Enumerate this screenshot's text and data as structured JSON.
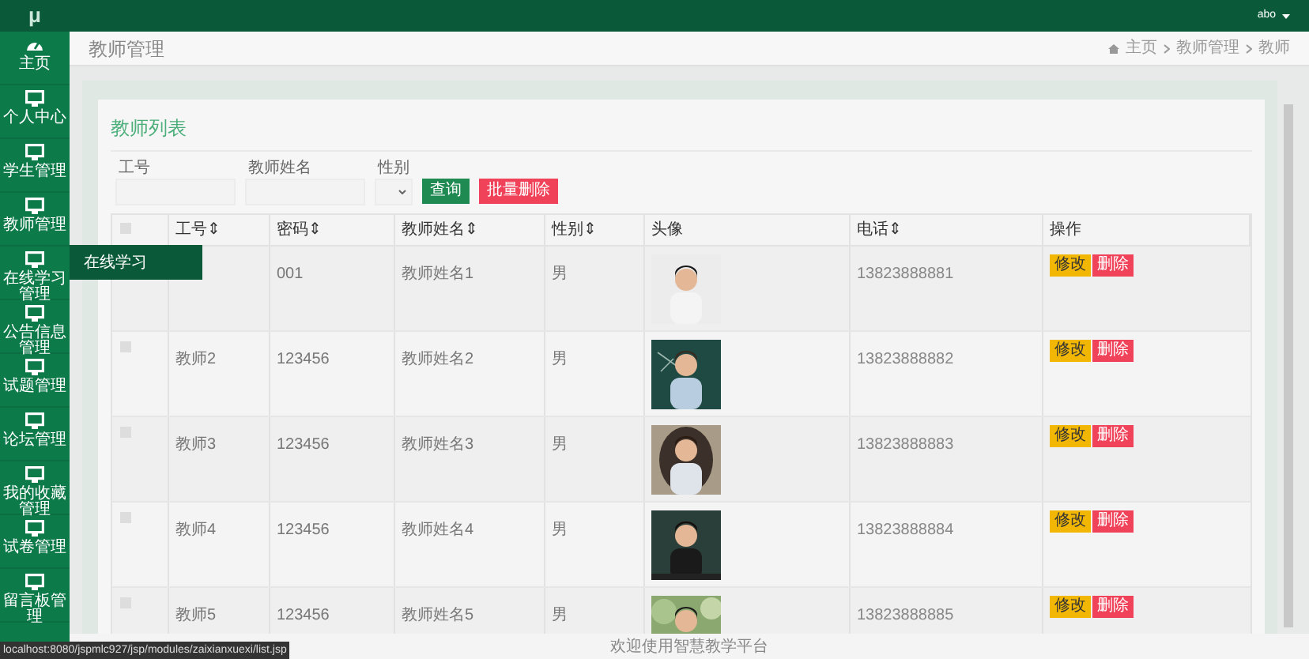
{
  "topbar": {
    "logo": "μ",
    "user": "abo"
  },
  "sidebar": {
    "items": [
      {
        "label": "主页",
        "kind": "dashboard"
      },
      {
        "label": "个人中心",
        "kind": "monitor"
      },
      {
        "label": "学生管理",
        "kind": "monitor"
      },
      {
        "label": "教师管理",
        "kind": "monitor"
      },
      {
        "label": "在线学习管理",
        "kind": "monitor"
      },
      {
        "label": "公告信息管理",
        "kind": "monitor"
      },
      {
        "label": "试题管理",
        "kind": "monitor"
      },
      {
        "label": "论坛管理",
        "kind": "monitor"
      },
      {
        "label": "我的收藏管理",
        "kind": "monitor"
      },
      {
        "label": "试卷管理",
        "kind": "monitor"
      },
      {
        "label": "留言板管理",
        "kind": "monitor"
      }
    ]
  },
  "flyout": {
    "label": "在线学习"
  },
  "header": {
    "title": "教师管理",
    "breadcrumb": [
      "主页",
      "教师管理",
      "教师"
    ]
  },
  "card": {
    "title": "教师列表",
    "filters": [
      {
        "label": "工号",
        "kind": "input"
      },
      {
        "label": "教师姓名",
        "kind": "input"
      },
      {
        "label": "性别",
        "kind": "select"
      }
    ],
    "buttons": [
      {
        "label": "查询",
        "kind": "primary"
      },
      {
        "label": "批量删除",
        "kind": "danger"
      }
    ],
    "table": {
      "select_all": {
        "checked": false
      },
      "columns": [
        {
          "label": "工号⇕"
        },
        {
          "label": "密码⇕"
        },
        {
          "label": "教师姓名⇕"
        },
        {
          "label": "性别⇕"
        },
        {
          "label": "头像"
        },
        {
          "label": "电话⇕"
        },
        {
          "label": "操作"
        }
      ],
      "rows": [
        {
          "password": "001",
          "name": "教师姓名1",
          "gender": "男",
          "avatar": {
            "kind": "picture"
          },
          "phone": "13823888881",
          "actions": [
            "修改",
            "删除"
          ]
        },
        {
          "checked": false,
          "id": "教师2",
          "password": "123456",
          "name": "教师姓名2",
          "gender": "男",
          "avatar": {
            "kind": "picture"
          },
          "phone": "13823888882",
          "actions": [
            "修改",
            "删除"
          ]
        },
        {
          "checked": false,
          "id": "教师3",
          "password": "123456",
          "name": "教师姓名3",
          "gender": "男",
          "avatar": {
            "kind": "picture"
          },
          "phone": "13823888883",
          "actions": [
            "修改",
            "删除"
          ]
        },
        {
          "checked": false,
          "id": "教师4",
          "password": "123456",
          "name": "教师姓名4",
          "gender": "男",
          "avatar": {
            "kind": "picture"
          },
          "phone": "13823888884",
          "actions": [
            "修改",
            "删除"
          ]
        },
        {
          "checked": false,
          "id": "教师5",
          "password": "123456",
          "name": "教师姓名5",
          "gender": "男",
          "avatar": {
            "kind": "picture"
          },
          "phone": "13823888885",
          "actions": [
            "修改",
            "删除"
          ]
        }
      ]
    }
  },
  "footer": "欢迎使用智慧教学平台",
  "status_bar": "localhost:8080/jspmlc927/jsp/modules/zaixianxuexi/list.jsp"
}
